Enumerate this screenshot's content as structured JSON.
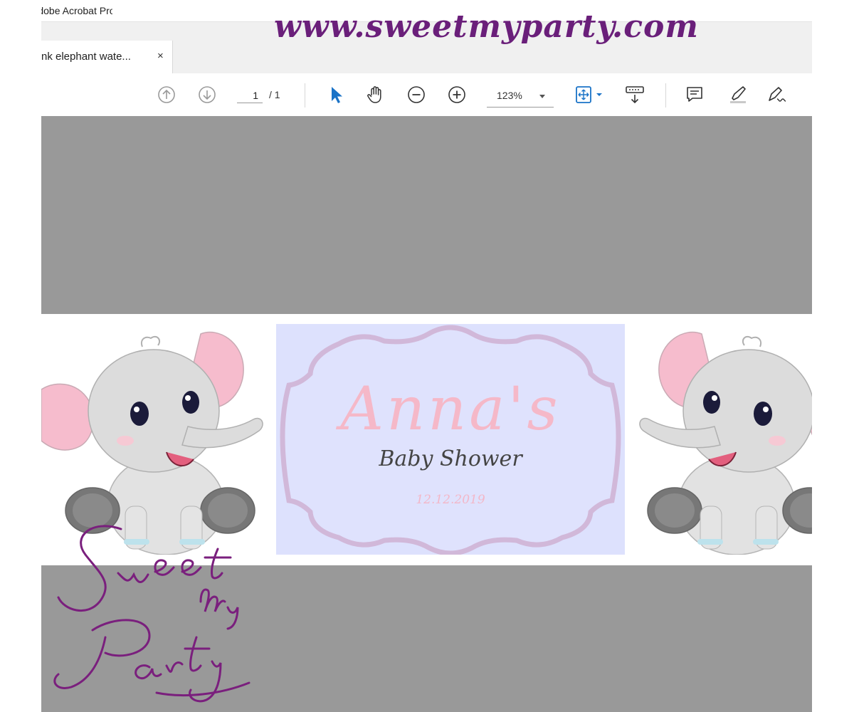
{
  "app": {
    "title": "Adobe Acrobat Pro DC"
  },
  "watermark": {
    "url": "www.sweetmyparty.com",
    "logo_text": "Sweet My Party"
  },
  "tab": {
    "title": "nk elephant wate...",
    "close": "×"
  },
  "toolbar": {
    "page_current": "1",
    "page_total_label": "/ 1",
    "zoom": "123%",
    "icons": [
      "arrow-up-icon",
      "arrow-down-icon",
      "select-cursor-icon",
      "hand-icon",
      "zoom-out-icon",
      "zoom-in-icon",
      "fit-page-icon",
      "scroll-mode-icon",
      "comment-icon",
      "highlight-icon",
      "sign-icon"
    ]
  },
  "document": {
    "name": "Anna's",
    "subtitle": "Baby Shower",
    "date": "12.12.2019"
  },
  "colors": {
    "watermark": "#6a1f7a",
    "doc_background": "#999999",
    "panel": "#dde1fd",
    "pink": "#f5b8c8",
    "accent_blue": "#1a73c7"
  }
}
